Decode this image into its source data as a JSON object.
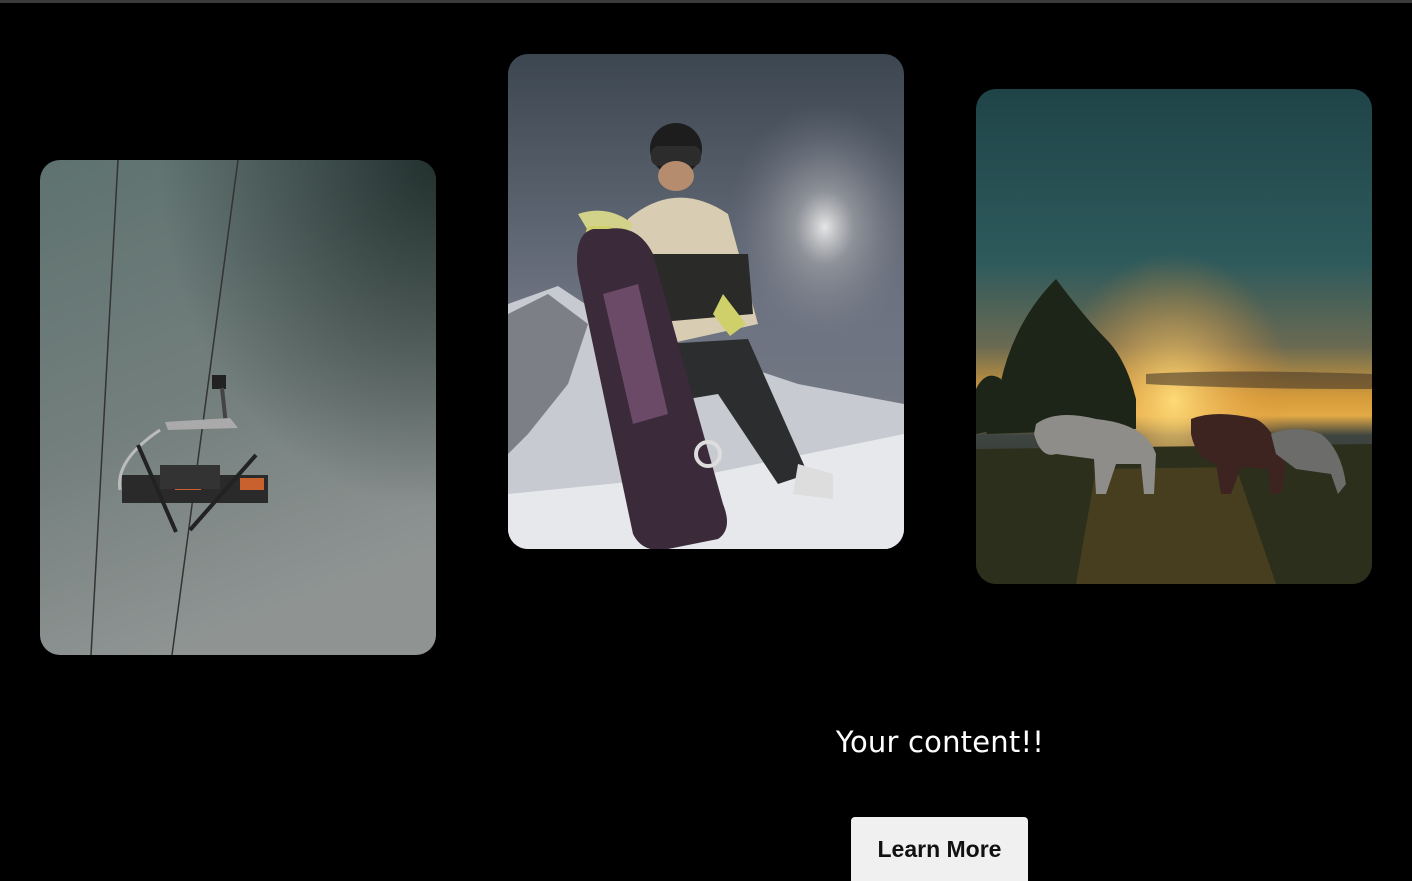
{
  "gallery": {
    "cards": [
      {
        "alt": "chairlift"
      },
      {
        "alt": "snowboarder"
      },
      {
        "alt": "horses at sunset"
      }
    ]
  },
  "content": {
    "text": "Your content!!",
    "button_label": "Learn More"
  },
  "colors": {
    "background": "#000000",
    "button_bg": "#f0f0f0",
    "text": "#ffffff"
  }
}
